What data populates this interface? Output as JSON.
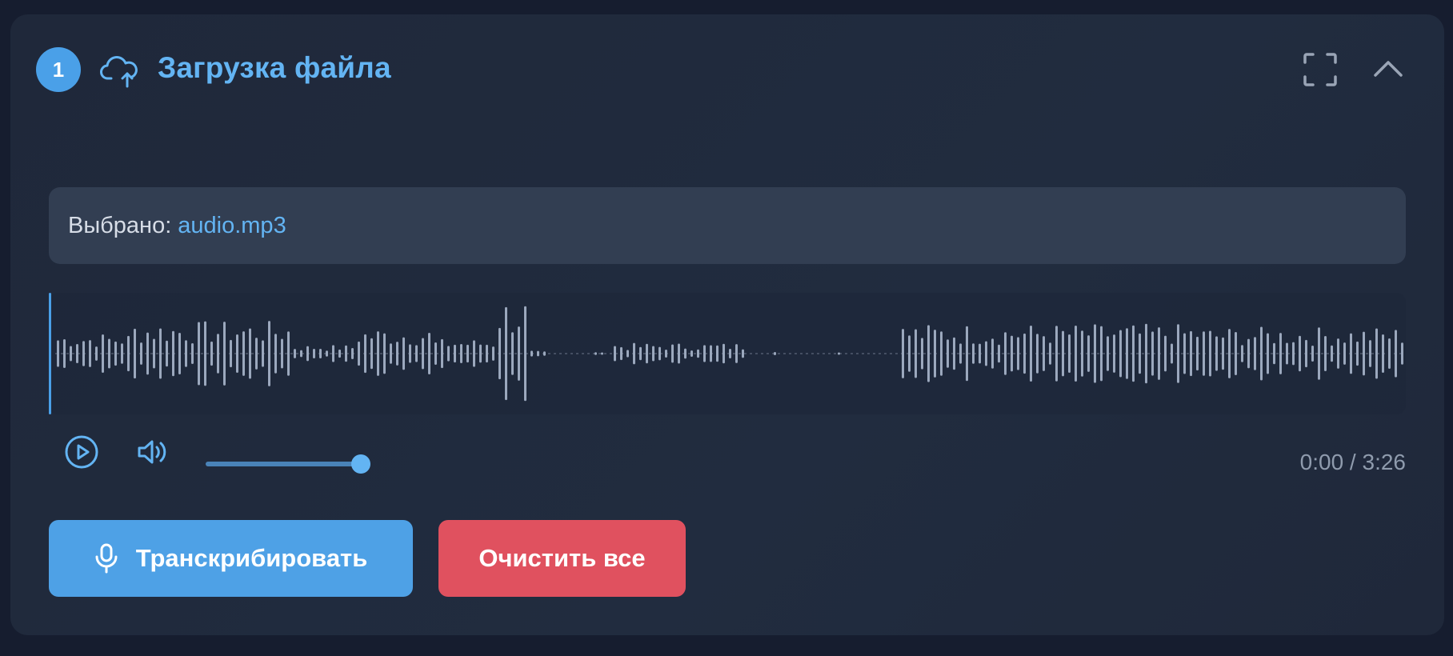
{
  "header": {
    "step_number": "1",
    "title": "Загрузка файла",
    "icon": "cloud-upload-icon",
    "actions": [
      "fullscreen-icon",
      "chevron-up-icon"
    ]
  },
  "file": {
    "prefix": "Выбрано:",
    "name": "audio.mp3"
  },
  "player": {
    "time": "0:00 / 3:26",
    "volume": 1.0,
    "progress": 0.0,
    "play_icon": "play-circle-icon",
    "volume_icon": "volume-icon"
  },
  "actions": {
    "transcribe_label": "Транскрибировать",
    "transcribe_icon": "microphone-icon",
    "clear_label": "Очистить все"
  },
  "colors": {
    "accent": "#4ea1e6",
    "title": "#63b4f3",
    "danger": "#e0515f",
    "background": "#161d2f",
    "panel": "#1f283a",
    "waveform": "#9ba8bd"
  }
}
